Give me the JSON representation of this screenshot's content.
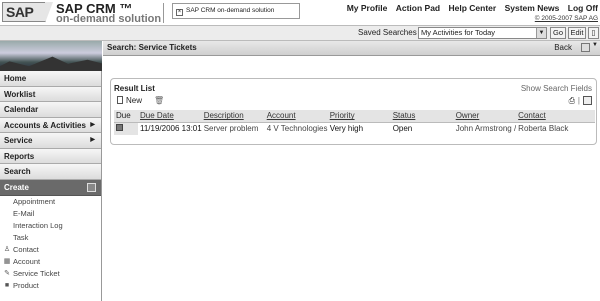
{
  "header": {
    "logo_text": "SAP",
    "product_name": "SAP CRM ™",
    "product_subtitle": "on-demand solution",
    "window_tab_label": "SAP CRM on-demand solution",
    "links": [
      "My Profile",
      "Action Pad",
      "Help Center",
      "System News",
      "Log Off"
    ],
    "copyright": "© 2005-2007 SAP AG"
  },
  "saved_searches": {
    "label": "Saved Searches",
    "selected": "My Activities for Today",
    "go_label": "Go",
    "edit_label": "Edit"
  },
  "sidebar": {
    "nav_items": [
      {
        "label": "Home",
        "has_submenu": false
      },
      {
        "label": "Worklist",
        "has_submenu": false
      },
      {
        "label": "Calendar",
        "has_submenu": false
      },
      {
        "label": "Accounts & Activities",
        "has_submenu": true
      },
      {
        "label": "Service",
        "has_submenu": true
      },
      {
        "label": "Reports",
        "has_submenu": false
      },
      {
        "label": "Search",
        "has_submenu": false
      }
    ],
    "create_header": "Create",
    "create_items": [
      {
        "label": "Appointment",
        "icon": ""
      },
      {
        "label": "E-Mail",
        "icon": ""
      },
      {
        "label": "Interaction Log",
        "icon": ""
      },
      {
        "label": "Task",
        "icon": ""
      },
      {
        "label": "Contact",
        "icon": "contact-icon"
      },
      {
        "label": "Account",
        "icon": "account-icon"
      },
      {
        "label": "Service Ticket",
        "icon": "service-ticket-icon"
      },
      {
        "label": "Product",
        "icon": "product-icon"
      }
    ]
  },
  "main": {
    "title": "Search: Service Tickets",
    "back_label": "Back",
    "result_list": {
      "title": "Result List",
      "show_search_fields": "Show Search Fields",
      "new_label": "New",
      "columns": [
        "Due",
        "Due Date",
        "Description",
        "Account",
        "Priority",
        "Status",
        "Owner",
        "Contact"
      ],
      "rows": [
        {
          "due": "",
          "due_date": "11/19/2006 13:01",
          "description": "Server problem",
          "account": "4 V Technologies",
          "priority": "Very high",
          "status": "Open",
          "owner": "John Armstrong /",
          "contact": "Roberta Black"
        }
      ]
    }
  }
}
